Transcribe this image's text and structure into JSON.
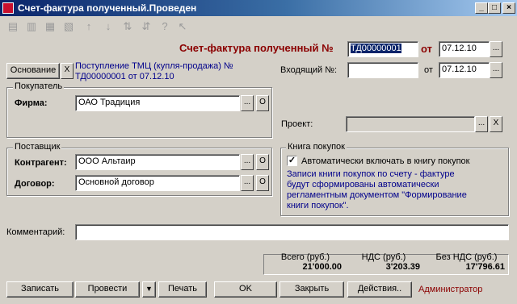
{
  "window": {
    "title": "Счет-фактура полученный.Проведен",
    "minimize": "_",
    "maximize": "□",
    "close": "×"
  },
  "toolbar": {
    "icons": [
      "add-row-icon",
      "copy-row-icon",
      "edit-row-icon",
      "delete-row-icon",
      "move-up-icon",
      "move-down-icon",
      "sort-asc-icon",
      "sort-desc-icon",
      "help-icon",
      "pointer-help-icon"
    ]
  },
  "header": {
    "doc_title": "Счет-фактура полученный №",
    "doc_number": "ТД00000001",
    "from_label": "от",
    "doc_date": "07.12.10",
    "incoming_label": "Входящий №:",
    "incoming_number": "",
    "incoming_from_label": "от",
    "incoming_date": "07.12.10"
  },
  "basis": {
    "button_label": "Основание",
    "clear": "X",
    "text": "Поступление ТМЦ (купля-продажа) № ТД00000001 от 07.12.10"
  },
  "buyer": {
    "legend": "Покупатель",
    "firm_label": "Фирма:",
    "firm_value": "ОАО Традиция",
    "select": "...",
    "open": "О"
  },
  "project": {
    "label": "Проект:",
    "value": "",
    "select": "...",
    "clear": "X"
  },
  "supplier": {
    "legend": "Поставщик",
    "contractor_label": "Контрагент:",
    "contractor_value": "ООО Альтаир",
    "contract_label": "Договор:",
    "contract_value": "Основной договор",
    "select": "...",
    "open": "О"
  },
  "purchase_book": {
    "legend": "Книга покупок",
    "checkbox_label": "Автоматически включать в книгу покупок",
    "checked": true,
    "note": "Записи книги покупок по счету - фактуре будут сформированы автоматически регламентным документом \"Формирование книги покупок\"."
  },
  "comment": {
    "label": "Комментарий:",
    "value": ""
  },
  "totals": {
    "total_label": "Всего (руб.)",
    "total_value": "21'000.00",
    "vat_label": "НДС (руб.)",
    "vat_value": "3'203.39",
    "novat_label": "Без НДС (руб.)",
    "novat_value": "17'796.61"
  },
  "buttons": {
    "save": "Записать",
    "post": "Провести",
    "post_menu": "▼",
    "print": "Печать",
    "ok": "OK",
    "close": "Закрыть",
    "actions": "Действия..",
    "user": "Администратор"
  }
}
